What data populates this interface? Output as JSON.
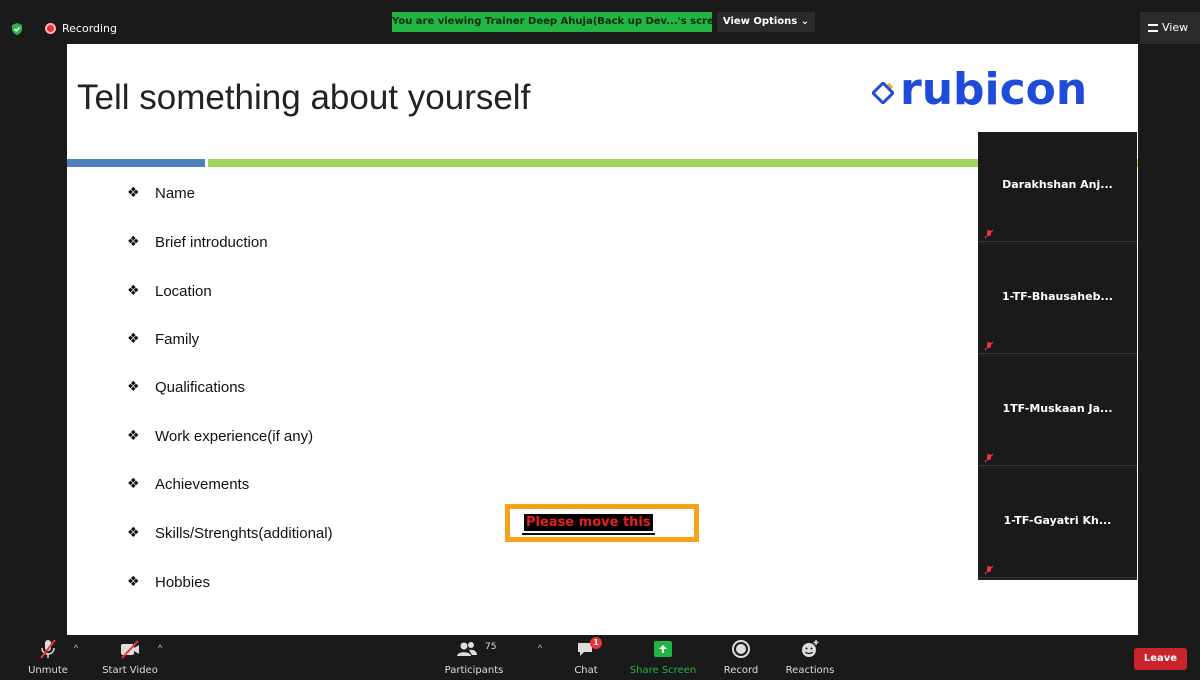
{
  "top_bar": {
    "recording_label": "Recording",
    "viewing_banner": "You are viewing Trainer Deep Ahuja(Back up Dev...'s screen",
    "view_options_label": "View Options ⌄",
    "view_label": "View"
  },
  "slide": {
    "title": "Tell something about yourself",
    "logo_text": "rubicon",
    "bullets": [
      "Name",
      "Brief introduction",
      "Location",
      "Family",
      "Qualifications",
      "Work experience(if any)",
      "Achievements",
      "Skills/Strenghts(additional)",
      "Hobbies"
    ],
    "sticker_text": "Please move this"
  },
  "participants": [
    {
      "name": "Darakhshan  Anj..."
    },
    {
      "name": "1-TF-Bhausaheb..."
    },
    {
      "name": "1TF-Muskaan  Ja..."
    },
    {
      "name": "1-TF-Gayatri  Kh..."
    }
  ],
  "toolbar": {
    "unmute_label": "Unmute",
    "start_video_label": "Start Video",
    "participants_label": "Participants",
    "participants_count": "75",
    "chat_label": "Chat",
    "chat_badge": "1",
    "share_screen_label": "Share Screen",
    "record_label": "Record",
    "reactions_label": "Reactions",
    "leave_label": "Leave"
  },
  "colors": {
    "viewing_banner_bg": "#22b543",
    "share_screen_green": "#22b543",
    "leave_red": "#c9242b",
    "logo_blue": "#1f4bd8",
    "bar_blue": "#4f81bd",
    "bar_green": "#9fd65f",
    "sticker_border": "#f7a21a"
  }
}
